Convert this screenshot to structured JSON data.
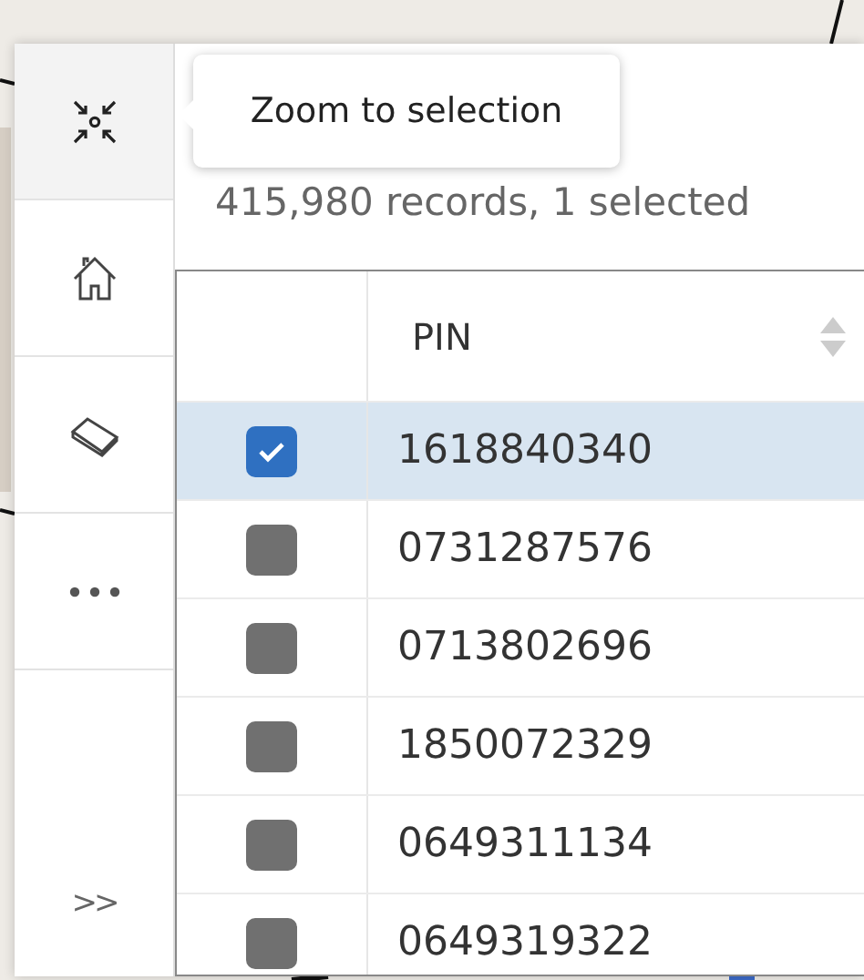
{
  "tools": [
    {
      "kind": "zoom",
      "selected": true
    },
    {
      "kind": "home",
      "selected": false
    },
    {
      "kind": "eraser",
      "selected": false
    },
    {
      "kind": "more",
      "selected": false
    }
  ],
  "collapse": {
    "label": ">>"
  },
  "tooltip": {
    "text": "Zoom to selection"
  },
  "summary": "415,980 records, 1 selected",
  "table": {
    "columns": [
      "PIN"
    ],
    "rows": [
      {
        "pin": "1618840340",
        "checked": true
      },
      {
        "pin": "0731287576",
        "checked": false
      },
      {
        "pin": "0713802696",
        "checked": false
      },
      {
        "pin": "1850072329",
        "checked": false
      },
      {
        "pin": "0649311134",
        "checked": false
      },
      {
        "pin": "0649319322",
        "checked": false
      }
    ]
  }
}
